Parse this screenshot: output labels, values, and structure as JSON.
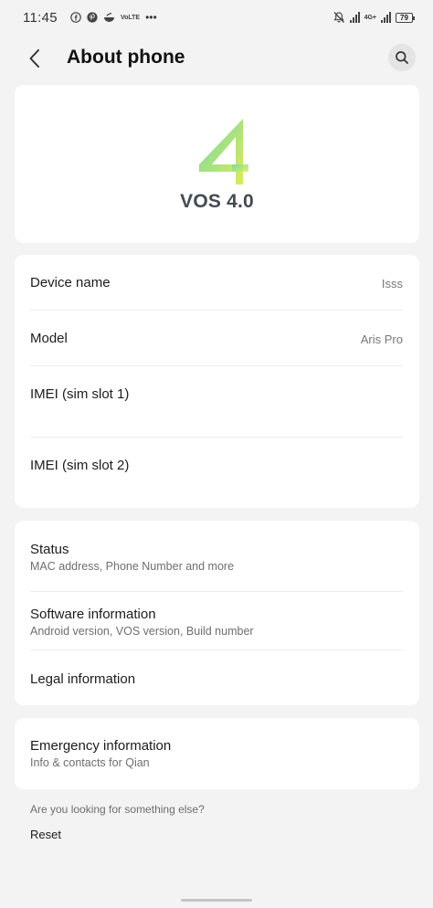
{
  "status_bar": {
    "time": "11:45",
    "battery": "79",
    "network": "4G+",
    "more": "•••",
    "volte": "VoLTE"
  },
  "header": {
    "title": "About phone"
  },
  "logo": {
    "version_text": "VOS 4.0",
    "mark_colors": [
      "#7fdca0",
      "#d8ec5c"
    ]
  },
  "info": {
    "device_name_label": "Device name",
    "device_name_value": "Isss",
    "model_label": "Model",
    "model_value": "Aris Pro",
    "imei1_label": "IMEI (sim slot 1)",
    "imei2_label": "IMEI (sim slot 2)"
  },
  "status_section": {
    "status_title": "Status",
    "status_sub": "MAC address, Phone Number and more",
    "software_title": "Software information",
    "software_sub": "Android version, VOS version, Build number",
    "legal_title": "Legal information"
  },
  "emergency": {
    "title": "Emergency information",
    "sub": "Info & contacts for Qian"
  },
  "footer": {
    "question": "Are you looking for something else?",
    "reset": "Reset"
  }
}
